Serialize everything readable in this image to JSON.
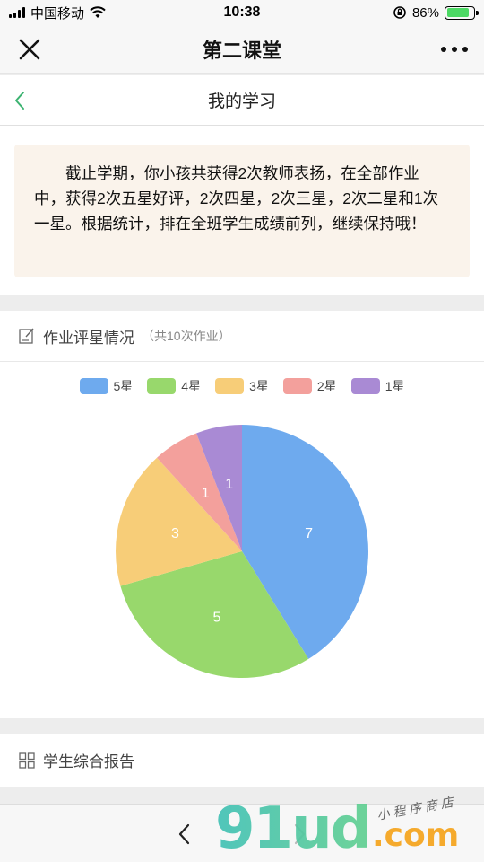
{
  "status_bar": {
    "carrier": "中国移动",
    "time": "10:38",
    "battery": "86%",
    "battery_level": 0.86
  },
  "nav": {
    "title": "第二课堂"
  },
  "page": {
    "title": "我的学习"
  },
  "summary": {
    "text": "截止学期，你小孩共获得2次教师表扬，在全部作业中，获得2次五星好评，2次四星，2次三星，2次二星和1次一星。根据统计，排在全班学生成绩前列，继续保持哦！"
  },
  "rating": {
    "title": "作业评星情况",
    "subtitle": "（共10次作业）"
  },
  "chart_data": {
    "type": "pie",
    "categories": [
      "5星",
      "4星",
      "3星",
      "2星",
      "1星"
    ],
    "values": [
      7,
      5,
      3,
      1,
      1
    ],
    "colors": [
      "#6eaaee",
      "#98d86c",
      "#f7cd78",
      "#f3a09c",
      "#a98ad4"
    ],
    "legend": "top"
  },
  "report": {
    "title": "学生综合报告"
  },
  "watermark": {
    "main": "91ud",
    "suffix": ".com",
    "tag": "小程序商店"
  }
}
